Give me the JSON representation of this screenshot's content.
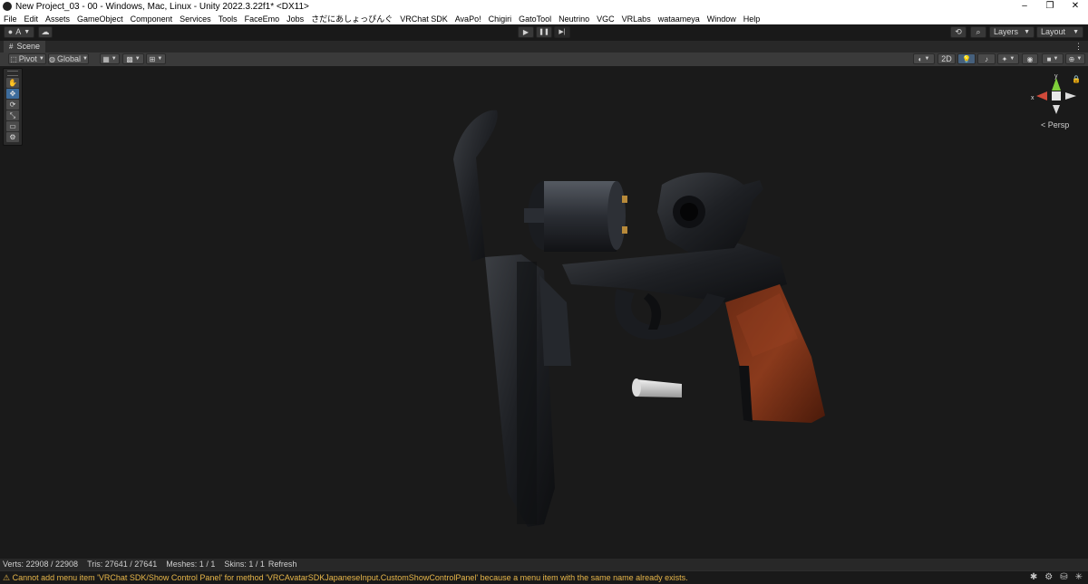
{
  "window": {
    "title": "New Project_03 - 00 - Windows, Mac, Linux - Unity 2022.3.22f1* <DX11>",
    "controls": {
      "minimize": "–",
      "maximize": "❐",
      "close": "✕"
    }
  },
  "menu": [
    "File",
    "Edit",
    "Assets",
    "GameObject",
    "Component",
    "Services",
    "Tools",
    "FaceEmo",
    "Jobs",
    "さだにあしょっぴんぐ",
    "VRChat SDK",
    "AvaPo!",
    "Chigiri",
    "GatoTool",
    "Neutrino",
    "VGC",
    "VRLabs",
    "wataameya",
    "Window",
    "Help"
  ],
  "toolbar": {
    "account_label": "A",
    "play_icon": "▶",
    "pause_icon": "❚❚",
    "step_icon": "▶|",
    "layers_label": "Layers",
    "layout_label": "Layout"
  },
  "scene_tab": {
    "label": "Scene"
  },
  "scene_options": {
    "pivot_label": "Pivot",
    "global_label": "Global",
    "mode_2d_label": "2D"
  },
  "tools": [
    "✋",
    "✥",
    "⟳",
    "⤡",
    "▭",
    "⚙"
  ],
  "gizmo": {
    "x_label": "x",
    "y_label": "y",
    "persp_label": "< Persp"
  },
  "stats": {
    "verts": "Verts: 22908 / 22908",
    "tris": "Tris: 27641 / 27641",
    "meshes": "Meshes: 1 / 1",
    "skins": "Skins: 1 / 1",
    "refresh_label": "Refresh"
  },
  "status": {
    "warning_icon": "⚠",
    "message": "Cannot add menu item 'VRChat SDK/Show Control Panel' for method 'VRCAvatarSDKJapaneseInput.CustomShowControlPanel' because a menu item with the same name already exists."
  },
  "colors": {
    "accent": "#3d6c9c",
    "warning": "#e8b74a",
    "viewport": "#1a1a1a",
    "grip_wood": "#7a2e18"
  }
}
